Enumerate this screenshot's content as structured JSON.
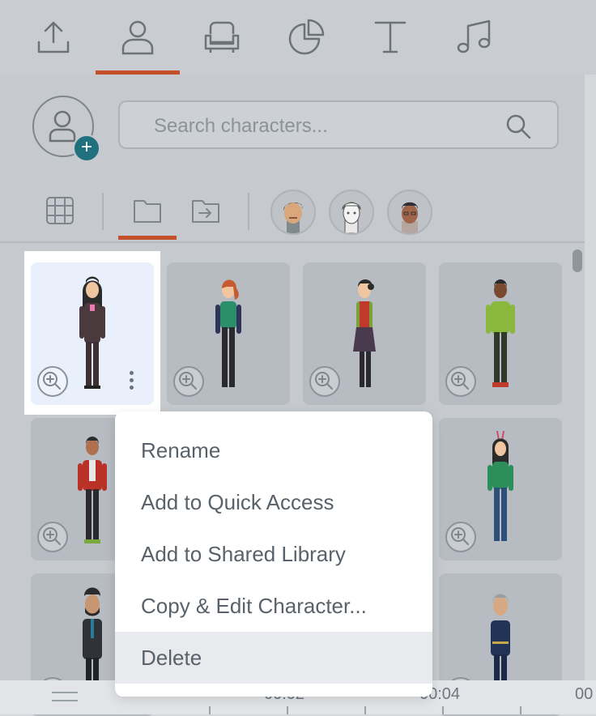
{
  "tabs": [
    {
      "name": "upload-tab",
      "icon": "upload-icon"
    },
    {
      "name": "characters-tab",
      "icon": "person-icon",
      "active": true
    },
    {
      "name": "props-tab",
      "icon": "armchair-icon"
    },
    {
      "name": "charts-tab",
      "icon": "pie-chart-icon"
    },
    {
      "name": "text-tab",
      "icon": "text-icon"
    },
    {
      "name": "audio-tab",
      "icon": "music-note-icon"
    }
  ],
  "search": {
    "placeholder": "Search characters..."
  },
  "filters": [
    {
      "icon": "grid-icon"
    },
    {
      "icon": "folder-icon",
      "active": true
    },
    {
      "icon": "folder-move-icon"
    }
  ],
  "accent_color": "#c4502a",
  "menu": {
    "items": [
      {
        "label": "Rename"
      },
      {
        "label": "Add to Quick Access"
      },
      {
        "label": "Add to Shared Library"
      },
      {
        "label": "Copy & Edit Character..."
      },
      {
        "label": "Delete",
        "highlighted": true
      }
    ]
  },
  "timeline": {
    "labels": [
      "00:02",
      "00:04",
      "00"
    ]
  }
}
